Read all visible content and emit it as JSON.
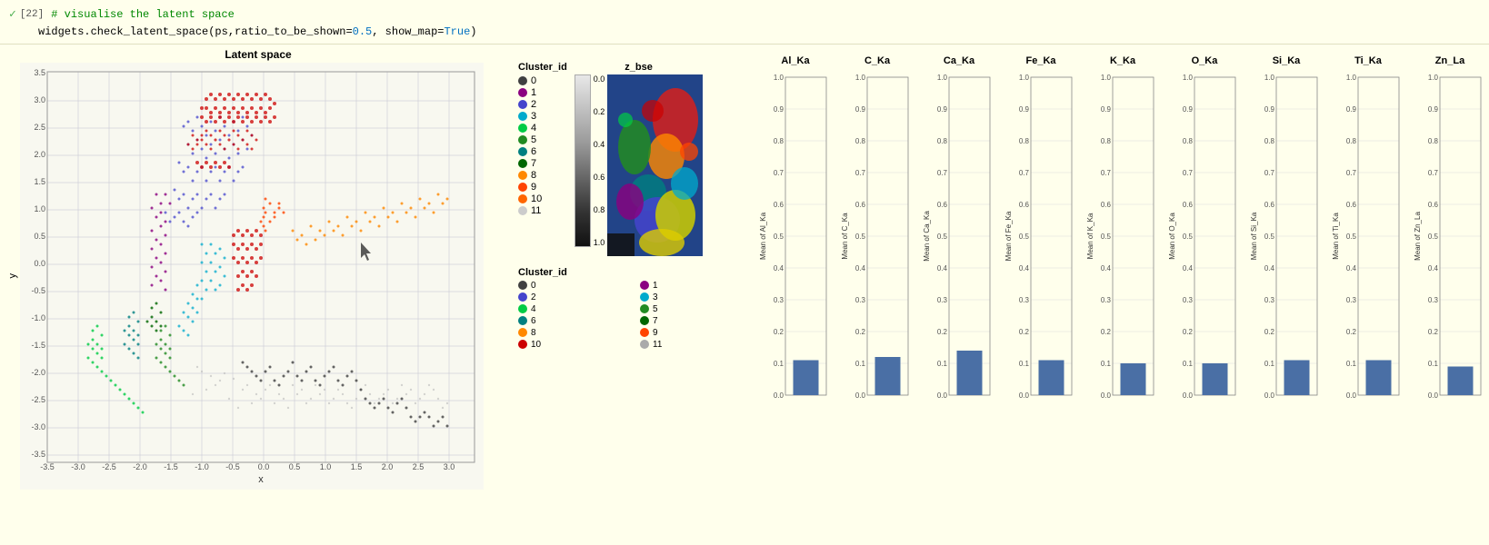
{
  "code": {
    "cell_num": "[22]",
    "line1_comment": "# visualise the latent space",
    "line2_code": "widgets.check_latent_space(ps,ratio_to_be_shown=",
    "line2_value1": "0.5",
    "line2_mid": ", show_map=",
    "line2_value2": "True",
    "line2_end": ")"
  },
  "scatter": {
    "title": "Latent space",
    "x_label": "x",
    "y_label": "y",
    "x_ticks": [
      "-3.5",
      "-3.0",
      "-2.5",
      "-2.0",
      "-1.5",
      "-1.0",
      "-0.5",
      "0.0",
      "0.5",
      "1.0",
      "1.5",
      "2.0",
      "2.5",
      "3.0"
    ],
    "y_ticks": [
      "-3.5",
      "-3.0",
      "-2.5",
      "-2.0",
      "-1.5",
      "-1.0",
      "-0.5",
      "0.0",
      "0.5",
      "1.0",
      "1.5",
      "2.0",
      "2.5",
      "3.0",
      "3.5"
    ]
  },
  "cluster_legend": {
    "title": "Cluster_id",
    "items": [
      {
        "id": "0",
        "color": "#404040"
      },
      {
        "id": "1",
        "color": "#8B0080"
      },
      {
        "id": "2",
        "color": "#4444cc"
      },
      {
        "id": "3",
        "color": "#00aacc"
      },
      {
        "id": "4",
        "color": "#00cc44"
      },
      {
        "id": "5",
        "color": "#228B22"
      },
      {
        "id": "6",
        "color": "#008080"
      },
      {
        "id": "7",
        "color": "#006600"
      },
      {
        "id": "8",
        "color": "#ff8800"
      },
      {
        "id": "9",
        "color": "#ff4400"
      },
      {
        "id": "10",
        "color": "#ff6600"
      },
      {
        "id": "11",
        "color": "#cccccc"
      }
    ]
  },
  "colorbar": {
    "title": "z_bse",
    "values": [
      "0.0",
      "0.2",
      "0.4",
      "0.6",
      "0.8",
      "1.0"
    ]
  },
  "cluster_legend_bottom": {
    "title": "Cluster_id",
    "items": [
      {
        "id": "0",
        "color": "#404040"
      },
      {
        "id": "1",
        "color": "#8B0080"
      },
      {
        "id": "2",
        "color": "#4444cc"
      },
      {
        "id": "3",
        "color": "#00aacc"
      },
      {
        "id": "4",
        "color": "#00cc44"
      },
      {
        "id": "5",
        "color": "#228B22"
      },
      {
        "id": "6",
        "color": "#008080"
      },
      {
        "id": "7",
        "color": "#006600"
      },
      {
        "id": "8",
        "color": "#ff8800"
      },
      {
        "id": "9",
        "color": "#ff4400"
      },
      {
        "id": "10",
        "color": "#cc0000"
      },
      {
        "id": "11",
        "color": "#aaaaaa"
      }
    ]
  },
  "bar_charts": [
    {
      "title": "Al_Ka",
      "y_label": "Mean of Al_Ka",
      "bar_height": 0.11,
      "bar_color": "#4a6fa5"
    },
    {
      "title": "C_Ka",
      "y_label": "Mean of C_Ka",
      "bar_height": 0.12,
      "bar_color": "#4a6fa5"
    },
    {
      "title": "Ca_Ka",
      "y_label": "Mean of Ca_Ka",
      "bar_height": 0.14,
      "bar_color": "#4a6fa5"
    },
    {
      "title": "Fe_Ka",
      "y_label": "Mean of Fe_Ka",
      "bar_height": 0.11,
      "bar_color": "#4a6fa5"
    },
    {
      "title": "K_Ka",
      "y_label": "Mean of K_Ka",
      "bar_height": 0.1,
      "bar_color": "#4a6fa5"
    },
    {
      "title": "O_Ka",
      "y_label": "Mean of O_Ka",
      "bar_height": 0.1,
      "bar_color": "#4a6fa5"
    },
    {
      "title": "Si_Ka",
      "y_label": "Mean of Si_Ka",
      "bar_height": 0.11,
      "bar_color": "#4a6fa5"
    },
    {
      "title": "Ti_Ka",
      "y_label": "Mean of Ti_Ka",
      "bar_height": 0.11,
      "bar_color": "#4a6fa5"
    },
    {
      "title": "Zn_La",
      "y_label": "Mean of Zn_La",
      "bar_height": 0.09,
      "bar_color": "#4a6fa5"
    }
  ]
}
